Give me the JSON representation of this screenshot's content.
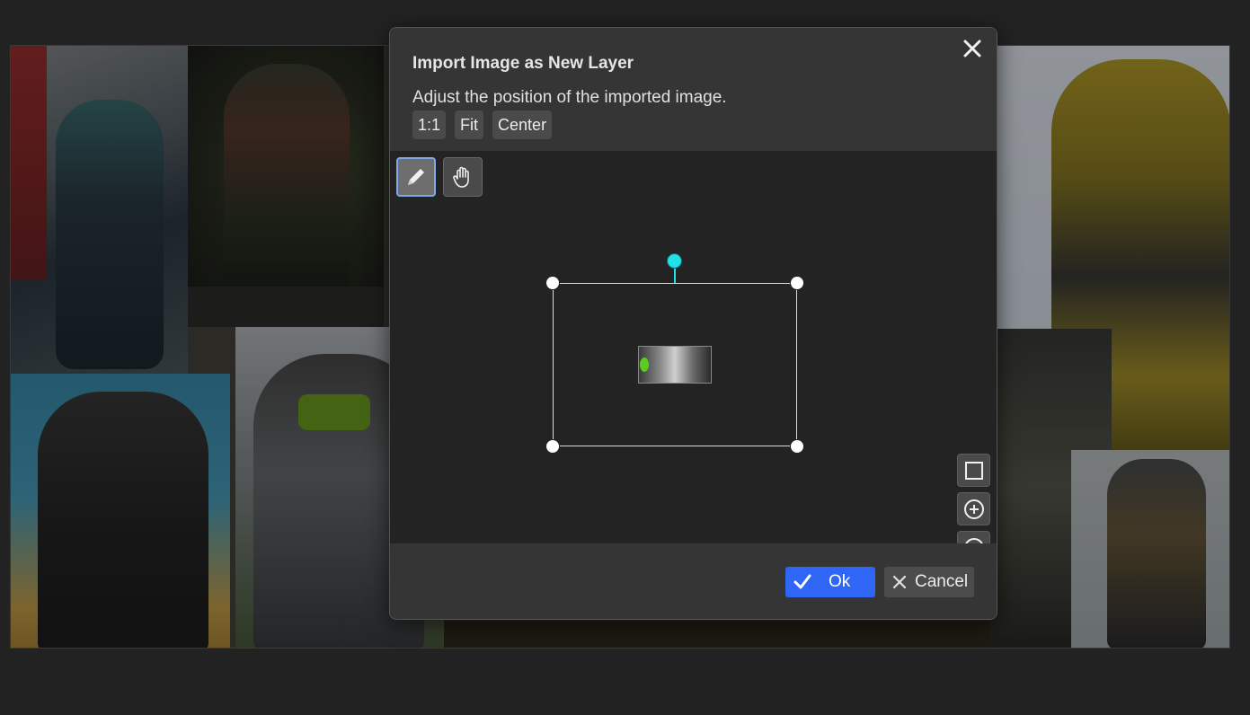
{
  "dialog": {
    "title": "Import Image as New Layer",
    "close_icon": "close-icon",
    "description": "Adjust the position of the imported image.",
    "buttons": {
      "one_to_one": "1:1",
      "fit": "Fit",
      "center": "Center"
    },
    "tools": [
      {
        "name": "pencil-icon",
        "active": true
      },
      {
        "name": "hand-icon",
        "active": false
      }
    ],
    "zoom": [
      {
        "name": "square-icon"
      },
      {
        "name": "zoom-in-icon"
      },
      {
        "name": "zoom-out-icon"
      }
    ],
    "ok_label": "Ok",
    "cancel_label": "Cancel"
  },
  "colors": {
    "accent": "#2f66f5",
    "rotation_handle": "#22e0e8",
    "dialog_bg": "#353535",
    "canvas_bg": "#232323"
  }
}
